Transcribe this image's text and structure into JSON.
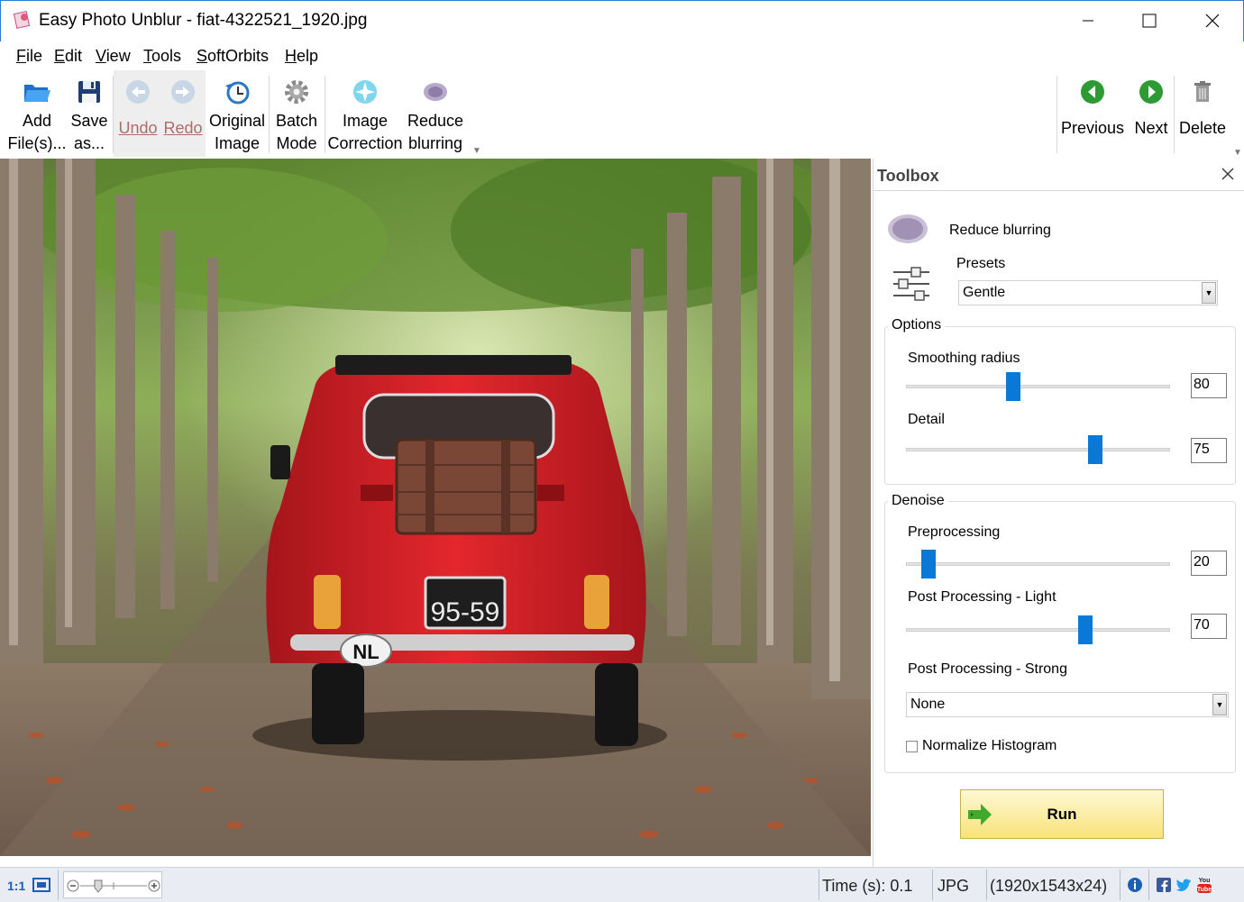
{
  "window": {
    "title": "Easy Photo Unblur - fiat-4322521_1920.jpg",
    "minimize_icon": "minimize-icon",
    "maximize_icon": "maximize-icon",
    "close_icon": "close-icon"
  },
  "menu": [
    "File",
    "Edit",
    "View",
    "Tools",
    "SoftOrbits",
    "Help"
  ],
  "toolbar": {
    "add_files": {
      "line1": "Add",
      "line2": "File(s)..."
    },
    "save_as": {
      "line1": "Save",
      "line2": "as..."
    },
    "undo": "Undo",
    "redo": "Redo",
    "original_image": {
      "line1": "Original",
      "line2": "Image"
    },
    "batch_mode": {
      "line1": "Batch",
      "line2": "Mode"
    },
    "image_correction": {
      "line1": "Image",
      "line2": "Correction"
    },
    "reduce_blurring": {
      "line1": "Reduce",
      "line2": "blurring"
    },
    "previous": "Previous",
    "next": "Next",
    "delete": "Delete"
  },
  "toolbox": {
    "title": "Toolbox",
    "tool_name": "Reduce blurring",
    "presets_label": "Presets",
    "preset_value": "Gentle",
    "options": {
      "title": "Options",
      "smoothing_radius": {
        "label": "Smoothing radius",
        "value": "80",
        "level": 0.4
      },
      "detail": {
        "label": "Detail",
        "value": "75",
        "level": 0.73
      }
    },
    "denoise": {
      "title": "Denoise",
      "preprocessing": {
        "label": "Preprocessing",
        "value": "20",
        "level": 0.06
      },
      "post_light": {
        "label": "Post Processing - Light",
        "value": "70",
        "level": 0.69
      },
      "post_strong_label": "Post Processing - Strong",
      "post_strong_value": "None",
      "normalize_label": "Normalize Histogram",
      "normalize_checked": false
    },
    "run_label": "Run"
  },
  "statusbar": {
    "zoom_label": "1:1",
    "time": "Time (s): 0.1",
    "format": "JPG",
    "dimensions": "(1920x1543x24)"
  }
}
